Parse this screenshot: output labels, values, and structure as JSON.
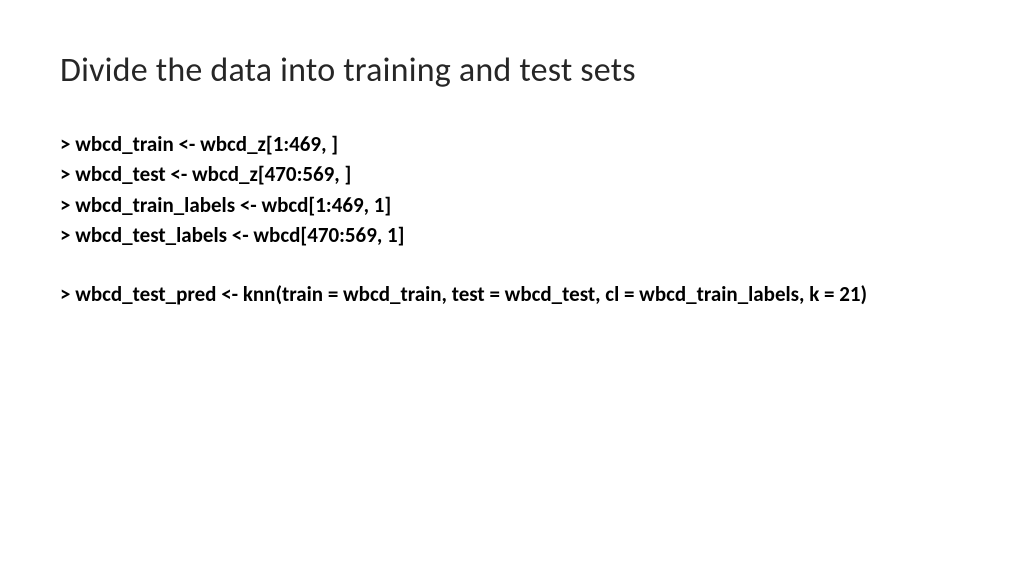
{
  "slide": {
    "title": "Divide the data into training and test sets",
    "code_lines": {
      "line1": "> wbcd_train <- wbcd_z[1:469, ]",
      "line2": "> wbcd_test <- wbcd_z[470:569, ]",
      "line3": "> wbcd_train_labels <- wbcd[1:469, 1]",
      "line4": "> wbcd_test_labels <- wbcd[470:569, 1]",
      "line5": "> wbcd_test_pred <- knn(train = wbcd_train, test = wbcd_test, cl = wbcd_train_labels, k = 21)"
    }
  }
}
